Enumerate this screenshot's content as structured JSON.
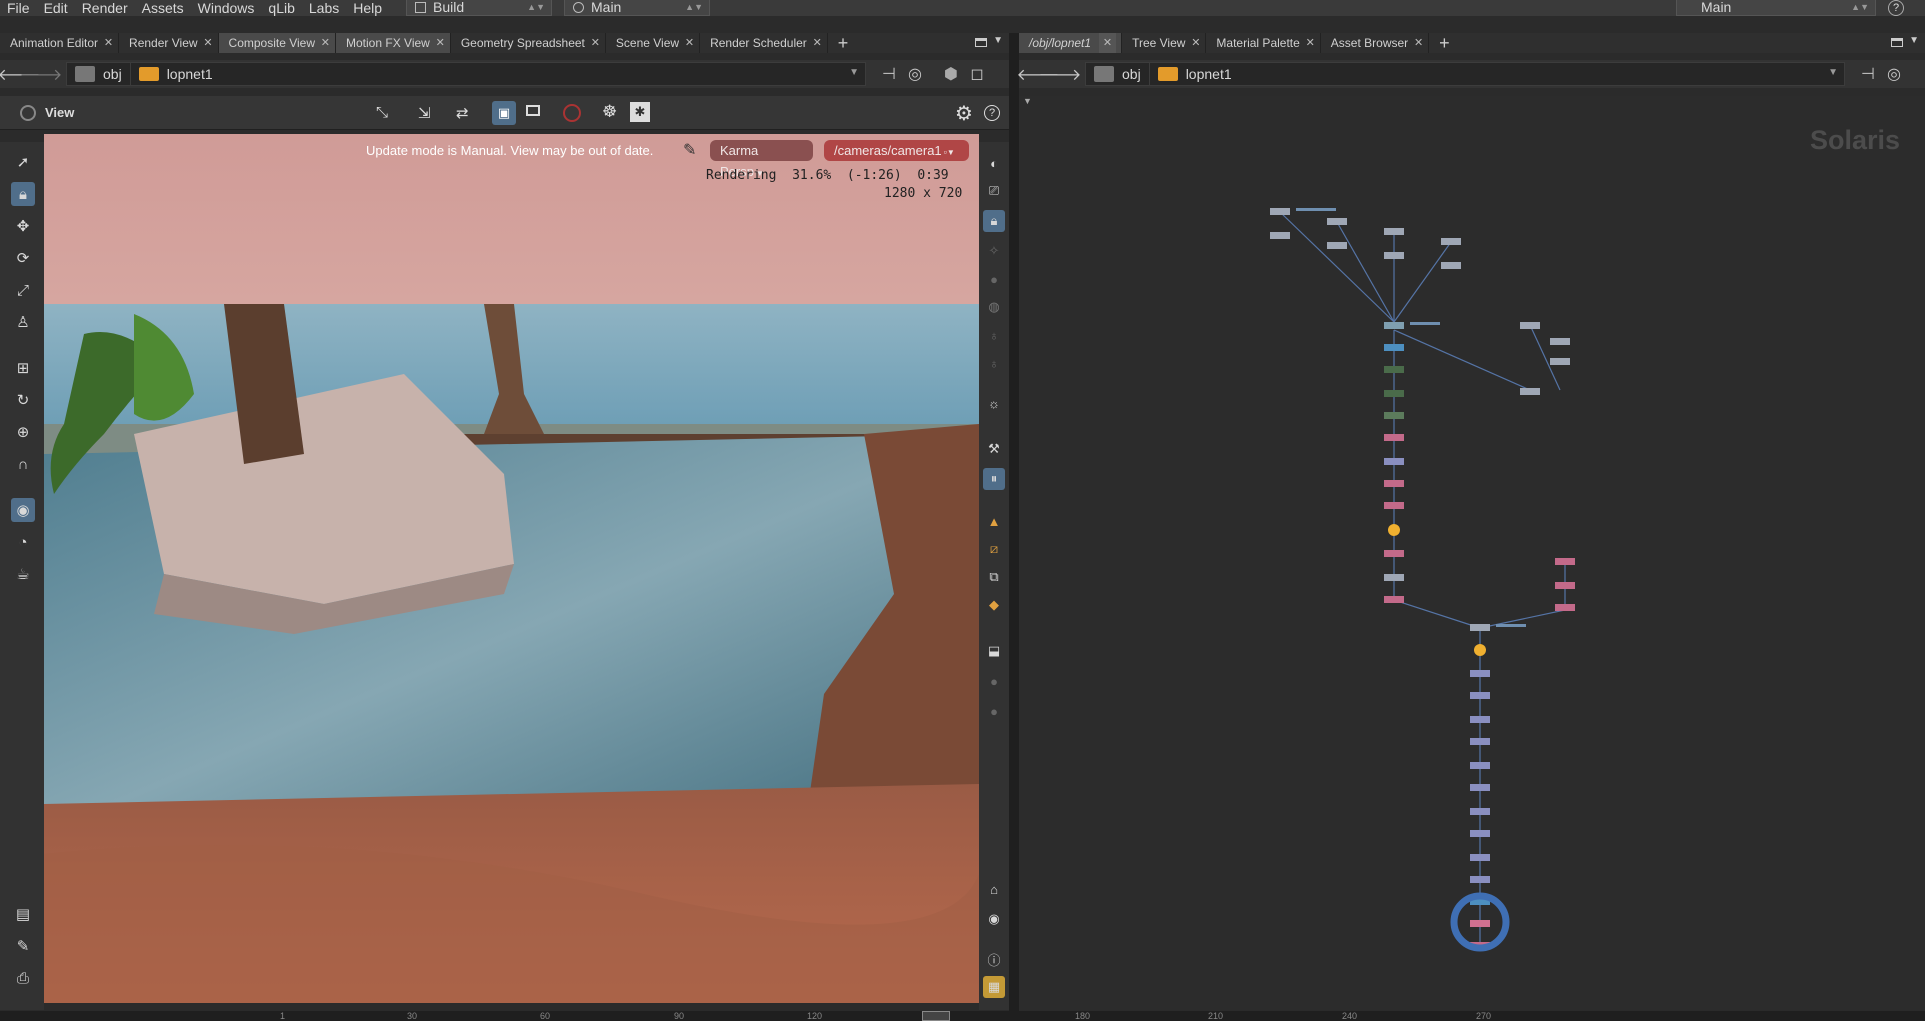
{
  "menu": [
    "File",
    "Edit",
    "Render",
    "Assets",
    "Windows",
    "qLib",
    "Labs",
    "Help"
  ],
  "desktop_combo": "Build",
  "context_combo": "Main",
  "right_combo": "Main",
  "left_tabs": [
    {
      "label": "Animation Editor",
      "active": false
    },
    {
      "label": "Render View",
      "active": false
    },
    {
      "label": "Composite View",
      "active": true
    },
    {
      "label": "Motion FX View",
      "active": true
    },
    {
      "label": "Geometry Spreadsheet",
      "active": false
    },
    {
      "label": "Scene View",
      "active": false
    },
    {
      "label": "Render Scheduler",
      "active": false
    }
  ],
  "right_tabs": [
    {
      "label": "/obj/lopnet1",
      "active": true
    },
    {
      "label": "Tree View",
      "active": false
    },
    {
      "label": "Material Palette",
      "active": false
    },
    {
      "label": "Asset Browser",
      "active": false
    }
  ],
  "left_path": {
    "a": "obj",
    "b": "lopnet1"
  },
  "right_path": {
    "a": "obj",
    "b": "lopnet1"
  },
  "view_label": "View",
  "viewport": {
    "update_msg": "Update mode is Manual. View may be out of date.",
    "renderer": "Karma Persp",
    "camera": "/cameras/camera1",
    "status_line": "Rendering  31.6%  (-1:26)  0:39",
    "resolution": "1280 x 720"
  },
  "network_label": "Solaris",
  "timeline_ticks": [
    "1",
    "30",
    "60",
    "90",
    "120",
    "180",
    "210",
    "240",
    "270"
  ],
  "colors": {
    "accent": "#506e8a",
    "karma": "#8a5050",
    "camera": "#b04646",
    "lop": "#e39b2b"
  }
}
